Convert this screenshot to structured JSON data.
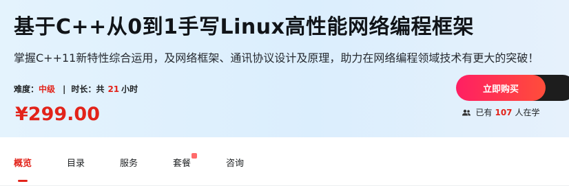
{
  "course": {
    "title": "基于C++从0到1手写Linux高性能网络编程框架",
    "subtitle": "掌握C++11新特性综合运用，及网络框架、通讯协议设计及原理，助力在网络编程领域技术有更大的突破！",
    "difficulty_label": "难度：",
    "difficulty_value": "中级",
    "separator": "|",
    "duration_label": "时长：",
    "duration_prefix": "共",
    "duration_value": "21",
    "duration_unit": "小时",
    "price": "¥299.00"
  },
  "purchase": {
    "buy_label": "立即购买",
    "learners_prefix": "已有",
    "learners_count": "107",
    "learners_suffix": "人在学"
  },
  "tabs": [
    {
      "label": "概览",
      "active": true
    },
    {
      "label": "目录",
      "active": false
    },
    {
      "label": "服务",
      "active": false
    },
    {
      "label": "套餐",
      "active": false
    },
    {
      "label": "咨询",
      "active": false
    }
  ],
  "colors": {
    "accent": "#e2231a",
    "button_start": "#ff1f63",
    "button_end": "#ff4d3a",
    "hero_bg": "#dbeefd"
  },
  "icons": {
    "learners": "users-icon",
    "tab_badge": "badge-icon"
  }
}
